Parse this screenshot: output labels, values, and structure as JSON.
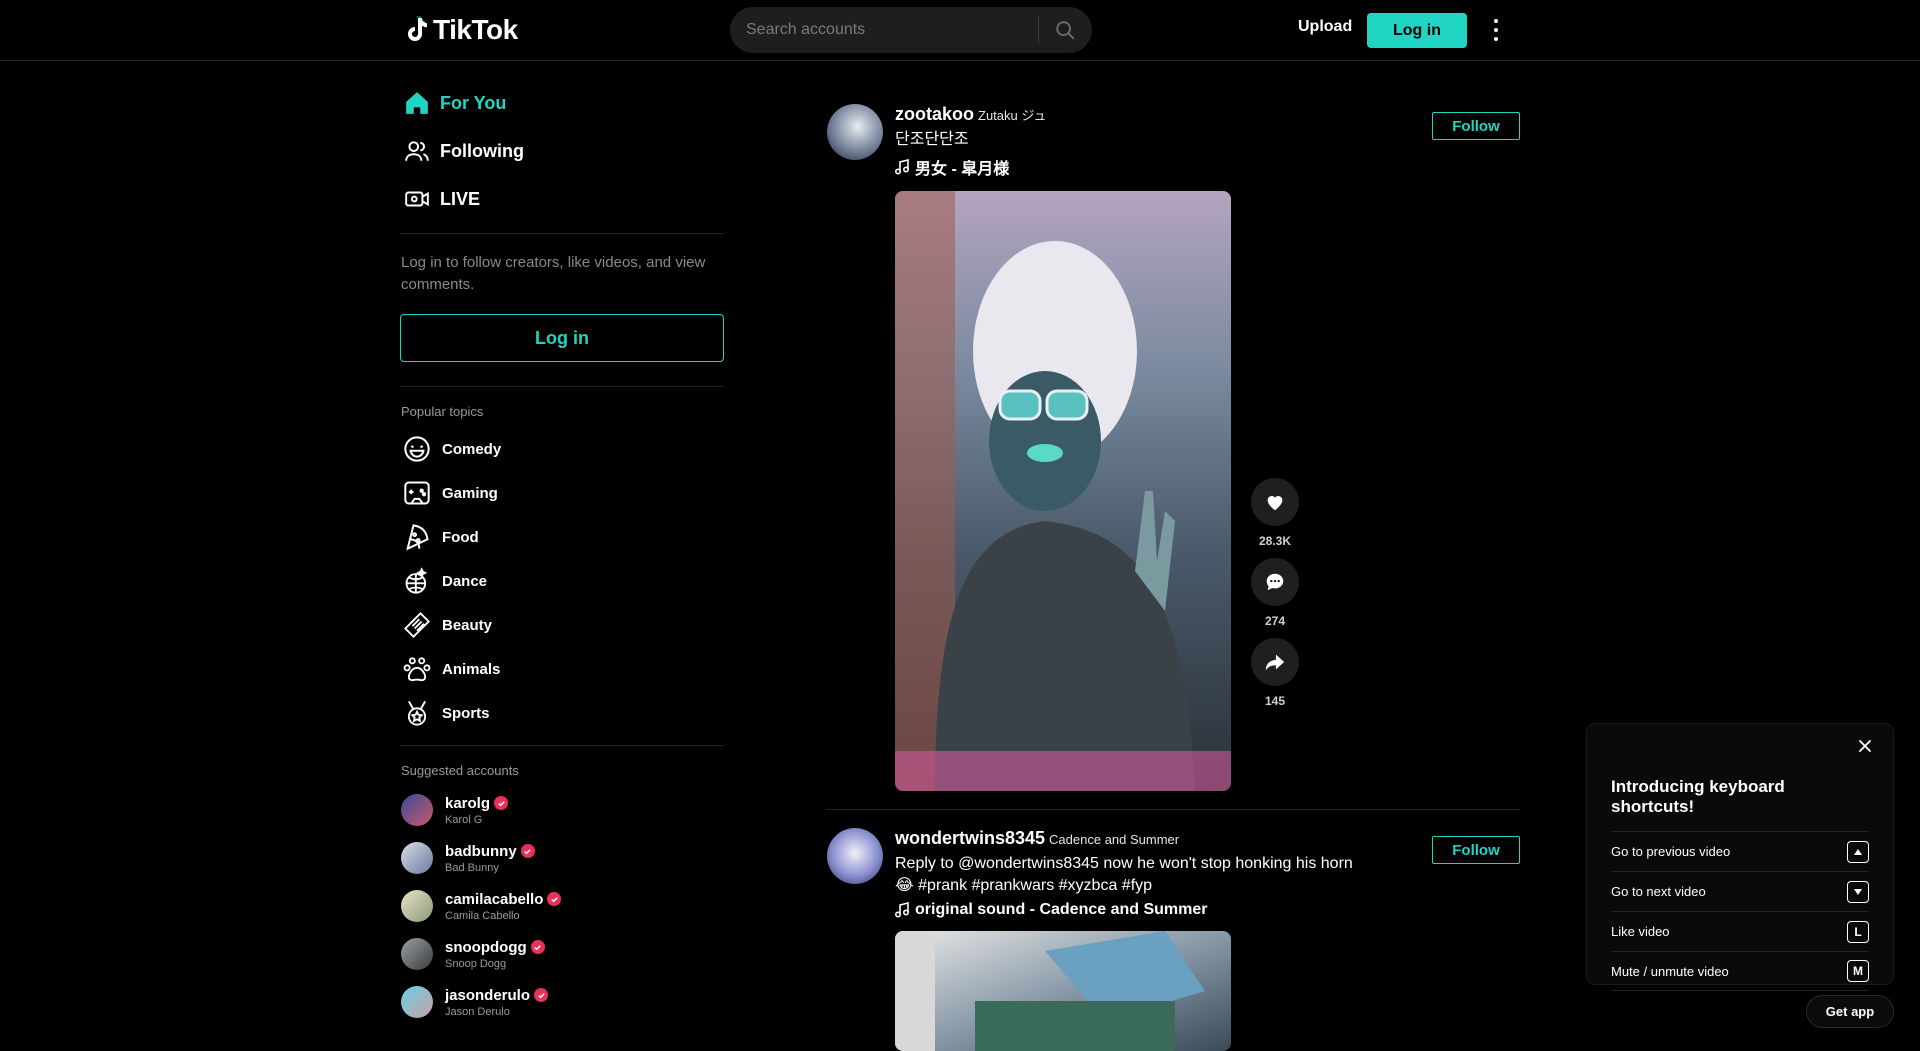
{
  "header": {
    "logo_text": "TikTok",
    "search_placeholder": "Search accounts",
    "upload_label": "Upload",
    "login_label": "Log in"
  },
  "sidebar": {
    "nav": [
      {
        "label": "For You",
        "icon": "home-icon"
      },
      {
        "label": "Following",
        "icon": "users-icon"
      },
      {
        "label": "LIVE",
        "icon": "live-icon"
      }
    ],
    "login_prompt": "Log in to follow creators, like videos, and view comments.",
    "login_label": "Log in",
    "popular_title": "Popular topics",
    "topics": [
      {
        "label": "Comedy",
        "icon": "comedy-icon"
      },
      {
        "label": "Gaming",
        "icon": "gaming-icon"
      },
      {
        "label": "Food",
        "icon": "food-icon"
      },
      {
        "label": "Dance",
        "icon": "dance-icon"
      },
      {
        "label": "Beauty",
        "icon": "beauty-icon"
      },
      {
        "label": "Animals",
        "icon": "animals-icon"
      },
      {
        "label": "Sports",
        "icon": "sports-icon"
      }
    ],
    "suggested_title": "Suggested accounts",
    "accounts": [
      {
        "username": "karolg",
        "name": "Karol G"
      },
      {
        "username": "badbunny",
        "name": "Bad Bunny"
      },
      {
        "username": "camilacabello",
        "name": "Camila Cabello"
      },
      {
        "username": "snoopdogg",
        "name": "Snoop Dogg"
      },
      {
        "username": "jasonderulo",
        "name": "Jason Derulo"
      }
    ]
  },
  "feed": {
    "posts": [
      {
        "username": "zootakoo",
        "nickname": "Zutaku ジュ",
        "description": "단조단단조",
        "music": "男女 - 皐月様",
        "follow_label": "Follow",
        "likes": "28.3K",
        "comments": "274",
        "shares": "145"
      },
      {
        "username": "wondertwins8345",
        "nickname": "Cadence and Summer",
        "description": "Reply to @wondertwins8345 now he won't stop honking his horn 😂 #prank #prankwars #xyzbca #fyp",
        "music": "original sound - Cadence and Summer",
        "follow_label": "Follow"
      }
    ]
  },
  "shortcuts": {
    "title": "Introducing keyboard shortcuts!",
    "rows": [
      {
        "label": "Go to previous video",
        "key_icon": "arrow-up"
      },
      {
        "label": "Go to next video",
        "key_icon": "arrow-down"
      },
      {
        "label": "Like video",
        "key": "L"
      },
      {
        "label": "Mute / unmute video",
        "key": "M"
      }
    ]
  },
  "get_app_label": "Get app",
  "colors": {
    "accent": "#20d5c4",
    "verified": "#e8315b",
    "background": "#000000"
  }
}
